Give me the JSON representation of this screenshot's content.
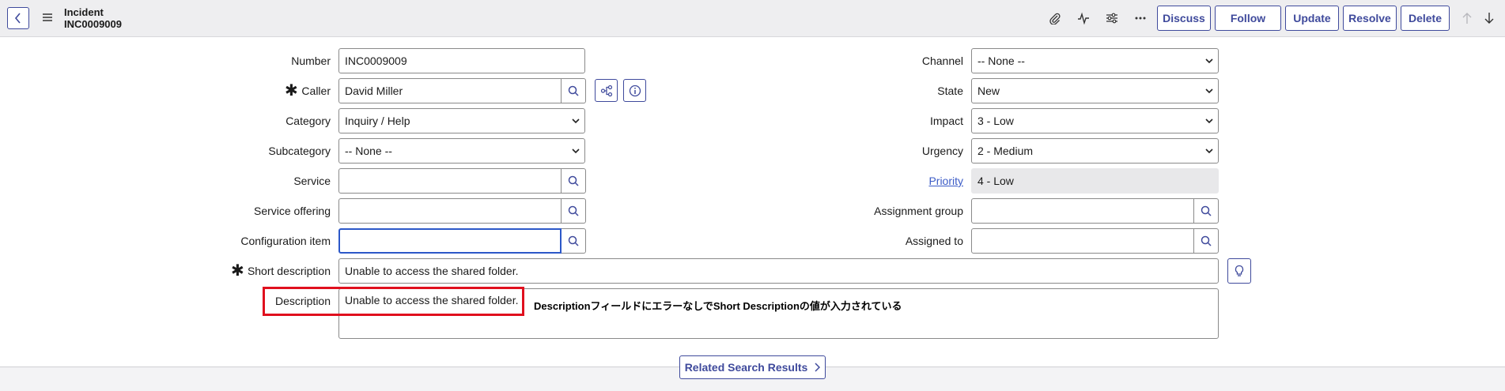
{
  "header": {
    "table": "Incident",
    "number": "INC0009009",
    "buttons": {
      "discuss": "Discuss",
      "follow": "Follow",
      "update": "Update",
      "resolve": "Resolve",
      "delete": "Delete"
    }
  },
  "form": {
    "number": {
      "label": "Number",
      "value": "INC0009009"
    },
    "caller": {
      "label": "Caller",
      "value": "David Miller",
      "required": "✱"
    },
    "category": {
      "label": "Category",
      "value": "Inquiry / Help"
    },
    "subcategory": {
      "label": "Subcategory",
      "value": "-- None --"
    },
    "service": {
      "label": "Service",
      "value": ""
    },
    "service_offering": {
      "label": "Service offering",
      "value": ""
    },
    "configuration_item": {
      "label": "Configuration item",
      "value": ""
    },
    "short_description": {
      "label": "Short description",
      "value": "Unable to access the shared folder.",
      "required": "✱"
    },
    "description": {
      "label": "Description",
      "value": "Unable to access the shared folder."
    },
    "channel": {
      "label": "Channel",
      "value": "-- None --"
    },
    "state": {
      "label": "State",
      "value": "New"
    },
    "impact": {
      "label": "Impact",
      "value": "3 - Low"
    },
    "urgency": {
      "label": "Urgency",
      "value": "2 - Medium"
    },
    "priority": {
      "label": "Priority",
      "value": "4 - Low"
    },
    "assignment_group": {
      "label": "Assignment group",
      "value": ""
    },
    "assigned_to": {
      "label": "Assigned to",
      "value": ""
    }
  },
  "annotation": "DescriptionフィールドにエラーなしでShort Descriptionの値が入力されている",
  "footer": {
    "related_search": "Related Search Results"
  },
  "colors": {
    "accent": "#3f4a9c",
    "highlight": "#e0101e",
    "focus": "#2c58c8"
  }
}
